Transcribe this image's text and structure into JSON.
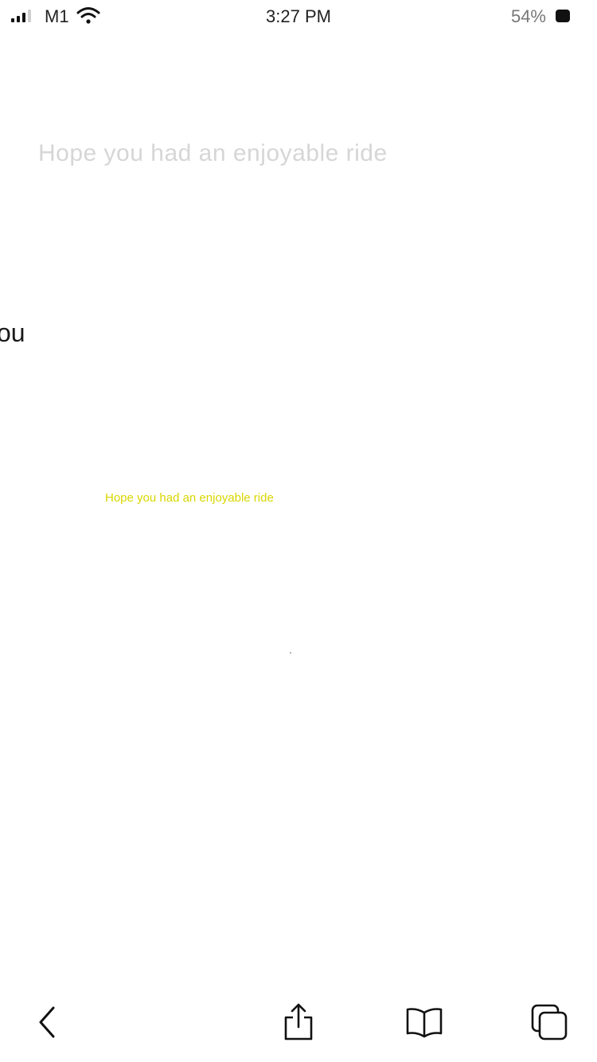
{
  "status_bar": {
    "carrier": "M1",
    "time": "3:27 PM",
    "battery_percent": "54%",
    "icons": [
      "signal-icon",
      "wifi-icon",
      "battery-icon"
    ]
  },
  "content": {
    "ghost_heading": "Hope you had an enjoyable ride",
    "partial_word": "ou",
    "yellow_message": "Hope you had an enjoyable ride"
  },
  "toolbar": {
    "items": [
      "back-icon",
      "share-icon",
      "bookmarks-icon",
      "tabs-icon"
    ]
  },
  "colors": {
    "background": "#ffffff",
    "ghost_text": "#d6d6d6",
    "highlight_text": "#d9d600",
    "icon": "#111111"
  }
}
